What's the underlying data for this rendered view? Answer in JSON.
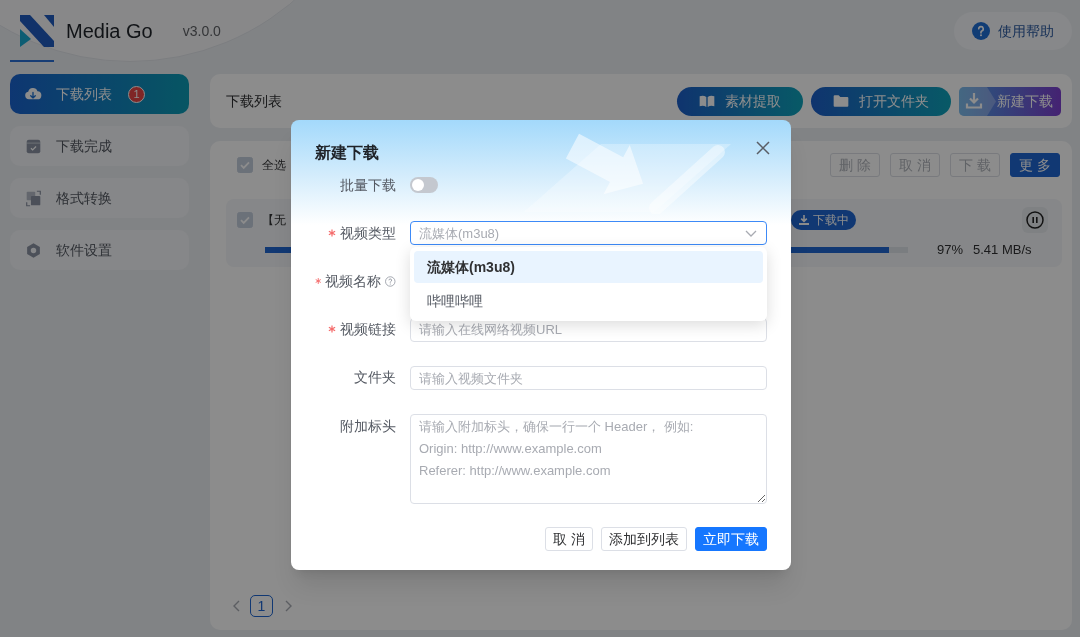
{
  "app": {
    "name": "Media Go",
    "version": "v3.0.0",
    "help": "使用帮助"
  },
  "sidebar": {
    "items": [
      {
        "label": "下载列表",
        "selected": true,
        "badge": "1"
      },
      {
        "label": "下载完成",
        "selected": false
      },
      {
        "label": "格式转换",
        "selected": false
      },
      {
        "label": "软件设置",
        "selected": false
      }
    ]
  },
  "toolbar": {
    "title": "下载列表",
    "buttons": [
      {
        "label": "素材提取",
        "kind": "secondary"
      },
      {
        "label": "打开文件夹",
        "kind": "secondary"
      },
      {
        "label": "新建下载",
        "kind": "primary"
      }
    ]
  },
  "list": {
    "select_all": {
      "label": "全选",
      "checked": true
    },
    "actions": [
      {
        "label": "删 除",
        "disabled": true
      },
      {
        "label": "取 消",
        "disabled": true
      },
      {
        "label": "下 载",
        "disabled": true
      },
      {
        "label": "更 多",
        "disabled": false
      }
    ],
    "items": [
      {
        "title": "【无",
        "checked": true,
        "status": "下载中",
        "level": 0.97,
        "percent": "97%",
        "speed": "5.41 MB/s"
      }
    ],
    "pagination": {
      "pages": [
        {
          "label": "1",
          "selected": true
        }
      ]
    }
  },
  "dialog": {
    "title": "新建下载",
    "fields": [
      {
        "kind": "switch",
        "label": "批量下载",
        "required": false,
        "on": false
      },
      {
        "kind": "select",
        "label": "视频类型",
        "required": true,
        "placeholder": "流媒体(m3u8)",
        "expanded": true,
        "options": [
          {
            "label": "流媒体(m3u8)",
            "selected": true
          },
          {
            "label": "哔哩哔哩",
            "selected": false
          }
        ]
      },
      {
        "kind": "input",
        "label": "视频名称",
        "required": true,
        "help": true,
        "covered": true
      },
      {
        "kind": "input",
        "label": "视频链接",
        "required": true,
        "placeholder": "请输入在线网络视频URL"
      },
      {
        "kind": "input",
        "label": "文件夹",
        "required": false,
        "placeholder": "请输入视频文件夹"
      },
      {
        "kind": "textarea",
        "label": "附加标头",
        "required": false,
        "placeholder": "请输入附加标头，确保一行一个 Header， 例如:\nOrigin: http://www.example.com\nReferer: http://www.example.com"
      }
    ],
    "buttons": [
      {
        "label": "取 消",
        "kind": "default"
      },
      {
        "label": "添加到列表",
        "kind": "default"
      },
      {
        "label": "立即下载",
        "kind": "primary"
      }
    ]
  }
}
